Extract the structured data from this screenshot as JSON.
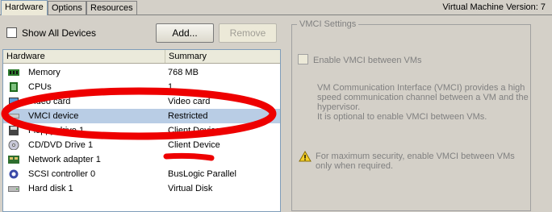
{
  "tabs": [
    {
      "label": "Hardware",
      "active": true
    },
    {
      "label": "Options",
      "active": false
    },
    {
      "label": "Resources",
      "active": false
    }
  ],
  "vm_version": "Virtual Machine Version: 7",
  "toolbar": {
    "show_all_devices": "Show All Devices",
    "add_label": "Add...",
    "remove_label": "Remove"
  },
  "hardware_table": {
    "columns": [
      "Hardware",
      "Summary"
    ],
    "rows": [
      {
        "name": "Memory",
        "summary": "768 MB",
        "icon": "memory-icon"
      },
      {
        "name": "CPUs",
        "summary": "1",
        "icon": "cpu-icon"
      },
      {
        "name": "Video card",
        "summary": "Video card",
        "icon": "video-card-icon"
      },
      {
        "name": "VMCI device",
        "summary": "Restricted",
        "icon": "vmci-device-icon",
        "selected": true
      },
      {
        "name": "Floppy drive 1",
        "summary": "Client Device",
        "icon": "floppy-icon"
      },
      {
        "name": "CD/DVD Drive 1",
        "summary": "Client Device",
        "icon": "cd-dvd-icon"
      },
      {
        "name": "Network adapter 1",
        "summary": "",
        "icon": "network-adapter-icon"
      },
      {
        "name": "SCSI controller 0",
        "summary": "BusLogic Parallel",
        "icon": "scsi-controller-icon"
      },
      {
        "name": "Hard disk 1",
        "summary": "Virtual Disk",
        "icon": "hard-disk-icon"
      }
    ]
  },
  "vmci_settings": {
    "title": "VMCI Settings",
    "enable_label": "Enable VMCI between VMs",
    "description_1": "VM Communication Interface (VMCI) provides a high speed communication channel between a VM and the hypervisor.",
    "description_2": "It is optional to enable VMCI between VMs.",
    "warning": "For maximum security, enable VMCI between VMs only when required."
  },
  "colors": {
    "annotation_red": "#ee0000",
    "selection": "#b9cde5"
  }
}
